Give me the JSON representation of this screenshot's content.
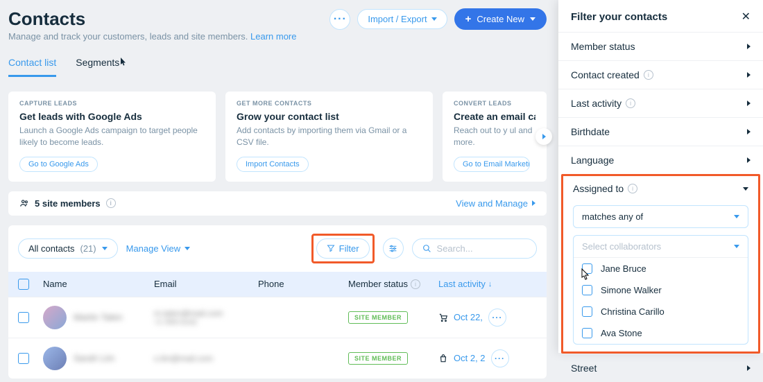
{
  "header": {
    "title": "Contacts",
    "subtitle": "Manage and track your customers, leads and site members. ",
    "learn_more": "Learn more",
    "more_label": "···",
    "import_export": "Import / Export",
    "create_new": "Create New"
  },
  "tabs": {
    "contact_list": "Contact list",
    "segments": "Segments"
  },
  "cards": [
    {
      "tag": "CAPTURE LEADS",
      "title": "Get leads with Google Ads",
      "desc": "Launch a Google Ads campaign to target people likely to become leads.",
      "cta": "Go to Google Ads"
    },
    {
      "tag": "GET MORE CONTACTS",
      "title": "Grow your contact list",
      "desc": "Add contacts by importing them via Gmail or a CSV file.",
      "cta": "Import Contacts"
    },
    {
      "tag": "CONVERT LEADS",
      "title": "Create an email ca",
      "desc": "Reach out to y      ul and more.",
      "cta": "Go to Email Marketing"
    }
  ],
  "site_members": {
    "label": "5 site members",
    "view_manage": "View and Manage"
  },
  "toolbar": {
    "all_contacts": "All contacts",
    "count": "(21)",
    "manage_view": "Manage View",
    "filter": "Filter",
    "search_placeholder": "Search..."
  },
  "columns": {
    "name": "Name",
    "email": "Email",
    "phone": "Phone",
    "status": "Member status",
    "activity": "Last activity"
  },
  "rows": [
    {
      "name": "Martin Talen",
      "email": "m.talen@mail.com",
      "email2": "+1 555-0142",
      "status": "SITE MEMBER",
      "activity": "Oct 22,"
    },
    {
      "name": "Sarah Lim",
      "email": "s.lim@mail.com",
      "email2": "",
      "status": "SITE MEMBER",
      "activity": "Oct 2, 2"
    }
  ],
  "panel": {
    "title": "Filter your contacts",
    "member_status": "Member status",
    "contact_created": "Contact created",
    "last_activity": "Last activity",
    "birthdate": "Birthdate",
    "language": "Language",
    "assigned_to": "Assigned to",
    "matches": "matches any of",
    "select_collab": "Select collaborators",
    "options": [
      "Jane Bruce",
      "Simone Walker",
      "Christina Carillo",
      "Ava Stone"
    ],
    "street": "Street"
  }
}
